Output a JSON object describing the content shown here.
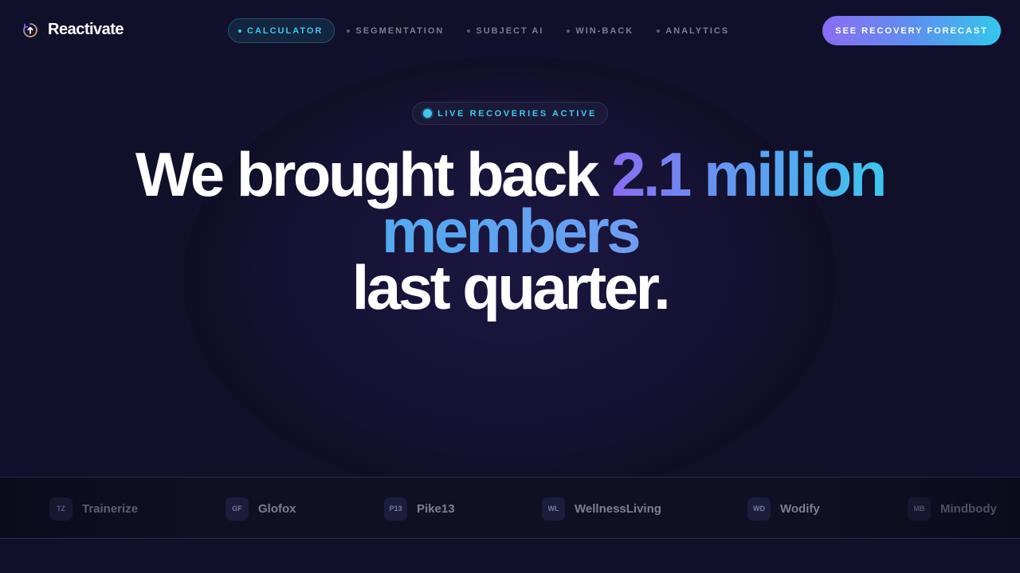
{
  "brand": {
    "name": "Reactivate",
    "icon": "logo-refresh-arrow-icon"
  },
  "nav": {
    "items": [
      {
        "label": "CALCULATOR",
        "active": true
      },
      {
        "label": "SEGMENTATION",
        "active": false
      },
      {
        "label": "SUBJECT AI",
        "active": false
      },
      {
        "label": "WIN-BACK",
        "active": false
      },
      {
        "label": "ANALYTICS",
        "active": false
      }
    ]
  },
  "cta": {
    "label": "SEE RECOVERY FORECAST"
  },
  "badge": {
    "label": "LIVE RECOVERIES ACTIVE"
  },
  "headline": {
    "part1": "We brought back ",
    "highlight1": "2.1 million",
    "highlight2": "members",
    "part2": "last quarter."
  },
  "partners": [
    {
      "abbr": "TZ",
      "name": "Trainerize"
    },
    {
      "abbr": "GF",
      "name": "Glofox"
    },
    {
      "abbr": "P13",
      "name": "Pike13"
    },
    {
      "abbr": "WL",
      "name": "WellnessLiving"
    },
    {
      "abbr": "WD",
      "name": "Wodify"
    },
    {
      "abbr": "MB",
      "name": "Mindbody"
    }
  ],
  "colors": {
    "background": "#11102a",
    "accent_cyan": "#3ec9ec",
    "accent_purple": "#8b6cf2",
    "accent_blue": "#5d8ef0"
  }
}
